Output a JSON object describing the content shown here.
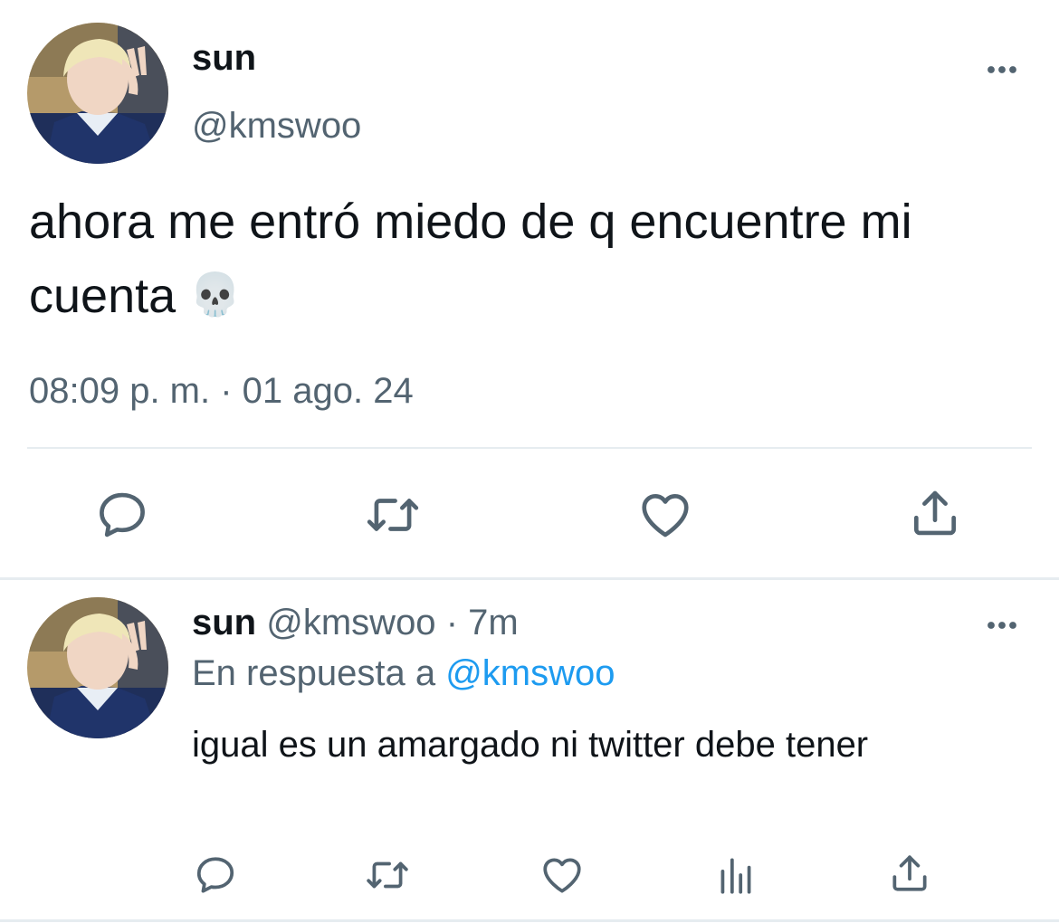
{
  "main_tweet": {
    "display_name": "sun",
    "handle": "@kmswoo",
    "text": "ahora me entró miedo de q encuentre mi cuenta",
    "emoji": "💀",
    "timestamp": "08:09 p. m. · 01 ago. 24",
    "icons": {
      "more": "more-horizontal-icon",
      "reply": "reply-icon",
      "retweet": "retweet-icon",
      "like": "heart-icon",
      "share": "share-icon"
    }
  },
  "reply_tweet": {
    "display_name": "sun",
    "handle": "@kmswoo",
    "separator": "·",
    "time_ago": "7m",
    "replying_to_prefix": "En respuesta a",
    "replying_to_handle": "@kmswoo",
    "text": "igual es un amargado ni twitter debe tener",
    "icons": {
      "more": "more-horizontal-icon",
      "reply": "reply-icon",
      "retweet": "retweet-icon",
      "like": "heart-icon",
      "analytics": "analytics-icon",
      "share": "share-icon"
    }
  },
  "colors": {
    "text": "#0f1419",
    "secondary": "#536471",
    "link": "#1d9bf0",
    "divider": "#e6ecf0"
  }
}
